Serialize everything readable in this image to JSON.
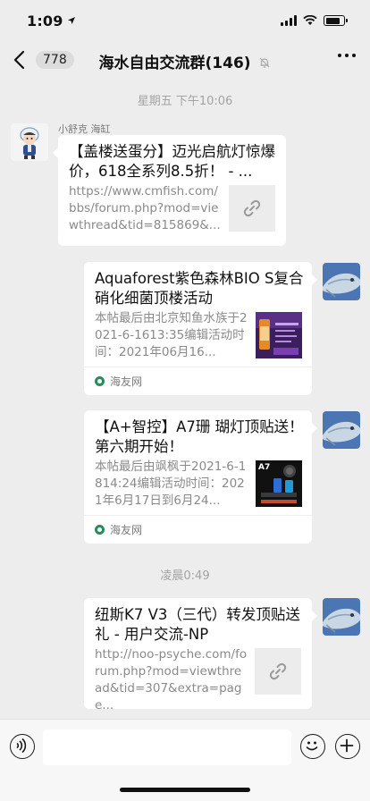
{
  "status_bar": {
    "time": "1:09",
    "battery_level": 0.8
  },
  "header": {
    "unread_count": "778",
    "title": "海水自由交流群(146)",
    "icons": {
      "back": "chevron-left-icon",
      "mute": "bell-off-icon",
      "more": "more-horizontal-icon"
    }
  },
  "messages": {
    "time_1": "星期五 下午10:06",
    "msg_1": {
      "sender": "小舒克 海缸",
      "title": "【盖楼送蛋分】迈光启航灯惊爆价，618全系列8.5折！ - ...",
      "desc": "https://www.cmfish.com/bbs/forum.php?mod=viewthread&tid=815869&...",
      "icon": "link-icon"
    },
    "msg_2": {
      "title": "Aquaforest紫色森林BIO S复合硝化细菌顶楼活动",
      "desc": "本帖最后由北京知鱼水族于2021-6-1613:35编辑活动时间：2021年06月16...",
      "source": "海友网"
    },
    "msg_3": {
      "title": "【A+智控】A7珊 瑚灯顶贴送！第六期开始！",
      "desc": "本帖最后由飒枫于2021-6-1814:24编辑活动时间：2021年6月17日到6月24...",
      "source": "海友网",
      "thumb_text": "A7"
    },
    "time_2": "凌晨0:49",
    "msg_4": {
      "title": "纽斯K7 V3（三代）转发顶贴送礼 - 用户交流-NP",
      "desc": "http://noo-psyche.com/forum.php?mod=viewthread&tid=307&extra=page...",
      "icon": "link-icon"
    }
  },
  "input_bar": {
    "icons": {
      "voice": "voice-icon",
      "emoji": "emoji-icon",
      "plus": "plus-icon"
    }
  },
  "colors": {
    "background": "#ededed",
    "bubble": "#ffffff",
    "muted_text": "#8a8a8a",
    "source_green": "#2b8a5b"
  }
}
